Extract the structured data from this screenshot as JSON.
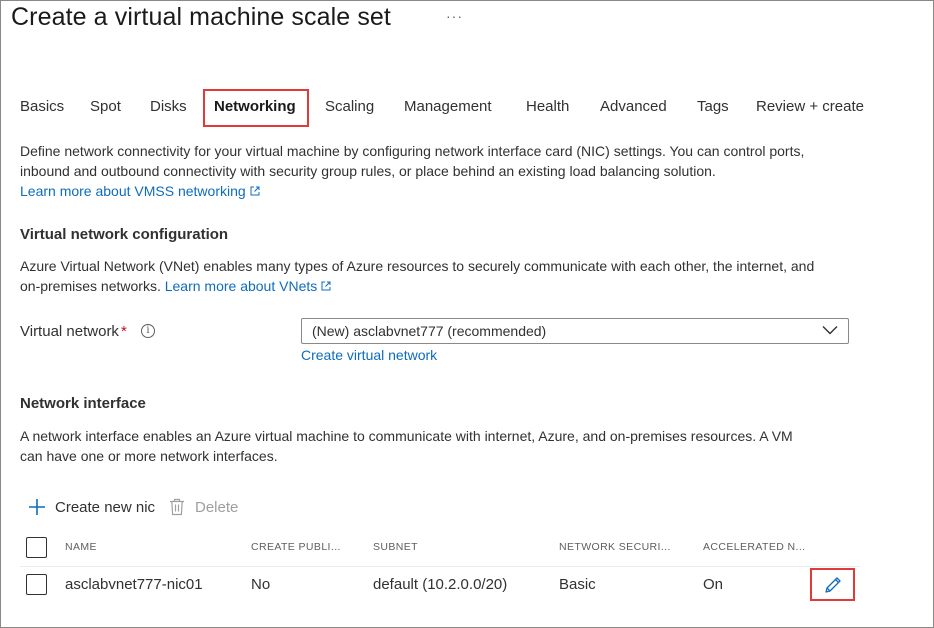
{
  "header": {
    "title": "Create a virtual machine scale set",
    "more_label": "···"
  },
  "tabs": [
    {
      "label": "Basics",
      "active": false
    },
    {
      "label": "Spot",
      "active": false
    },
    {
      "label": "Disks",
      "active": false
    },
    {
      "label": "Networking",
      "active": true
    },
    {
      "label": "Scaling",
      "active": false
    },
    {
      "label": "Management",
      "active": false
    },
    {
      "label": "Health",
      "active": false
    },
    {
      "label": "Advanced",
      "active": false
    },
    {
      "label": "Tags",
      "active": false
    },
    {
      "label": "Review + create",
      "active": false
    }
  ],
  "intro": {
    "line1": "Define network connectivity for your virtual machine by configuring network interface card (NIC) settings. You can control ports,",
    "line2": "inbound and outbound connectivity with security group rules, or place behind an existing load balancing solution.",
    "learn_more": "Learn more about VMSS networking"
  },
  "vnet_config": {
    "heading": "Virtual network configuration",
    "desc_line1": "Azure Virtual Network (VNet) enables many types of Azure resources to securely communicate with each other, the internet, and",
    "desc_line2": "on-premises networks.",
    "learn_more": "Learn more about VNets",
    "field_label": "Virtual network",
    "required_mark": "*",
    "info_icon": "i",
    "selected_value": "(New) asclabvnet777 (recommended)",
    "create_link": "Create virtual network"
  },
  "network_interface": {
    "heading": "Network interface",
    "desc_line1": "A network interface enables an Azure virtual machine to communicate with internet, Azure, and on-premises resources. A VM",
    "desc_line2": "can have one or more network interfaces.",
    "create_label": "Create new nic",
    "delete_label": "Delete",
    "columns": [
      "NAME",
      "CREATE PUBLI...",
      "SUBNET",
      "NETWORK SECURI...",
      "ACCELERATED N..."
    ],
    "rows": [
      {
        "name": "asclabvnet777-nic01",
        "create_public": "No",
        "subnet": "default (10.2.0.0/20)",
        "nsg": "Basic",
        "accelerated": "On"
      }
    ]
  },
  "colors": {
    "link": "#0f6cbd",
    "highlight": "#e03a3a",
    "required": "#c50f1f"
  },
  "icons": [
    "more-icon",
    "external-link-icon",
    "info-icon",
    "chevron-down-icon",
    "plus-icon",
    "trash-icon",
    "pencil-icon"
  ]
}
